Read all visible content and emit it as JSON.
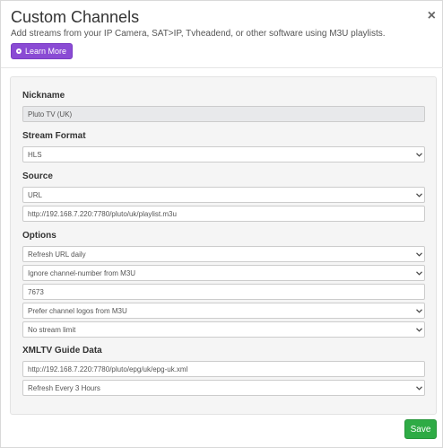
{
  "modal": {
    "title": "Custom Channels",
    "subtitle": "Add streams from your IP Camera, SAT>IP, Tvheadend, or other software using M3U playlists.",
    "learn_more_label": "Learn More",
    "close_glyph": "×",
    "save_label": "Save"
  },
  "form": {
    "nickname": {
      "label": "Nickname",
      "value": "Pluto TV (UK)"
    },
    "stream_format": {
      "label": "Stream Format",
      "value": "HLS"
    },
    "source": {
      "label": "Source",
      "type": "URL",
      "url": "http://192.168.7.220:7780/pluto/uk/playlist.m3u"
    },
    "options": {
      "label": "Options",
      "refresh": "Refresh URL daily",
      "channel_number": "Ignore channel-number from M3U",
      "start_number": "7673",
      "logos": "Prefer channel logos from M3U",
      "stream_limit": "No stream limit"
    },
    "xmltv": {
      "label": "XMLTV Guide Data",
      "url": "http://192.168.7.220:7780/pluto/epg/uk/epg-uk.xml",
      "refresh": "Refresh Every 3 Hours"
    }
  },
  "colors": {
    "learn_more": "#8a4bd4",
    "save": "#2eab45",
    "panel": "#f5f5f5"
  },
  "icons": [
    "close-icon",
    "info-icon",
    "chevron-down-icon"
  ]
}
